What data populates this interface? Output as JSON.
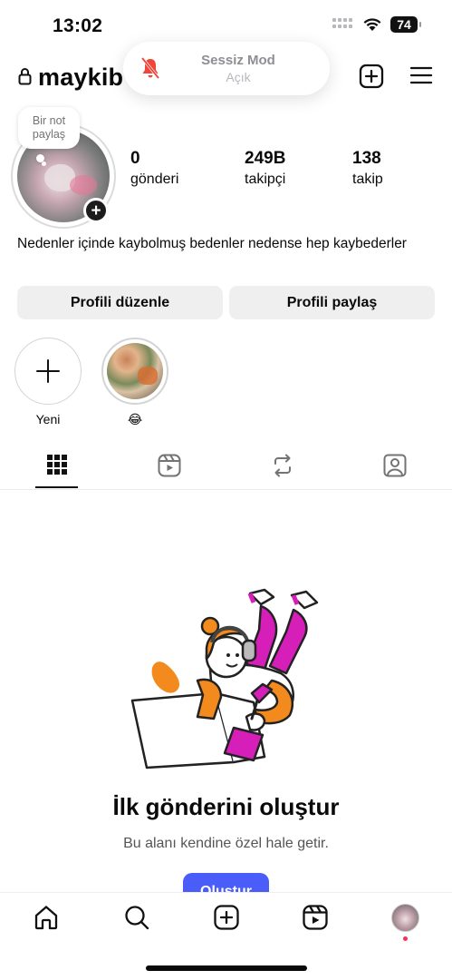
{
  "status_bar": {
    "time": "13:02",
    "battery": "74"
  },
  "silent_mode_toast": {
    "title": "Sessiz Mod",
    "state": "Açık",
    "icon": "bell-slash-icon"
  },
  "header": {
    "username": "maykib",
    "icons": [
      "lock-icon",
      "add-square-icon",
      "menu-icon"
    ]
  },
  "profile": {
    "note_bubble": "Bir not paylaş",
    "stats": [
      {
        "value": "0",
        "label": "gönderi"
      },
      {
        "value": "249B",
        "label": "takipçi"
      },
      {
        "value": "138",
        "label": "takip"
      }
    ],
    "bio": "Nedenler içinde kaybolmuş bedenler nedense hep kaybederler",
    "buttons": {
      "edit": "Profili düzenle",
      "share": "Profili paylaş"
    }
  },
  "highlights": [
    {
      "label": "Yeni",
      "type": "new"
    },
    {
      "label": "😂",
      "type": "highlight"
    }
  ],
  "tabs": [
    {
      "icon": "grid-icon",
      "active": true
    },
    {
      "icon": "reels-icon",
      "active": false
    },
    {
      "icon": "repost-icon",
      "active": false
    },
    {
      "icon": "tagged-icon",
      "active": false
    }
  ],
  "empty_state": {
    "title": "İlk gönderini oluştur",
    "subtitle": "Bu alanı kendine özel hale getir.",
    "button": "Oluştur"
  },
  "bottom_nav": {
    "items": [
      "home-icon",
      "search-icon",
      "create-icon",
      "reels-icon",
      "profile-avatar"
    ]
  },
  "colors": {
    "accent": "#4a5df9",
    "illustration_orange": "#f28a1e",
    "illustration_magenta": "#d61fb8",
    "button_bg": "#efeff0",
    "notification_dot": "#ff2d55"
  }
}
